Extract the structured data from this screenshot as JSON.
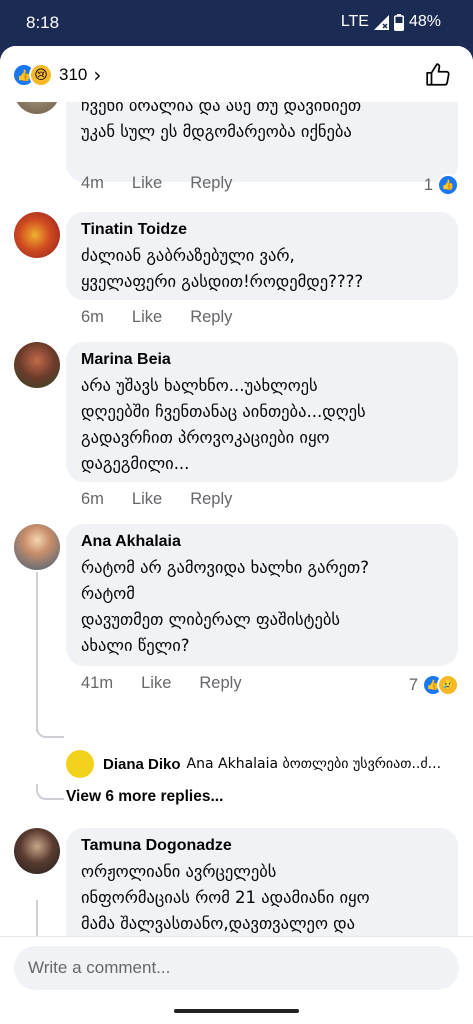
{
  "status": {
    "time": "8:18",
    "network": "LTE",
    "battery": "48%"
  },
  "header": {
    "reaction_count": "310",
    "icons": [
      "like-icon",
      "sad-icon",
      "chevron-right-icon",
      "thumbs-up-icon"
    ]
  },
  "comments": [
    {
      "author": "",
      "text": "ჩვენი ბრალია და ასე თუ დავიხიეთ\nუკან სულ ეს მდგომარეობა იქნება",
      "time": "4m",
      "like": "Like",
      "reply": "Reply",
      "reactions": "1"
    },
    {
      "author": "Tinatin Toidze",
      "text": "ძალიან გაბრაზებული ვარ,\nყველაფერი გასდით!როდემდე????",
      "time": "6m",
      "like": "Like",
      "reply": "Reply"
    },
    {
      "author": "Marina Beia",
      "text": "არა უშავს  ხალხნო...უახლოეს\nდღეებში ჩვენთანაც აინთება...დღეს\nგადავრჩით პროვოკაციები იყო\nდაგეგმილი...",
      "time": "6m",
      "like": "Like",
      "reply": "Reply"
    },
    {
      "author": "Ana Akhalaia",
      "text": "რატომ არ გამოვიდა ხალხი გარეთ?\nრატომ\nდავუთმეთ ლიბერალ ფაშისტებს\nახალი წელი?",
      "time": "41m",
      "like": "Like",
      "reply": "Reply",
      "reactions": "7",
      "reply_preview": {
        "author": "Diana Diko",
        "text": "Ana Akhalaia ბოთლები უსვრიათ..ძ..."
      },
      "more_replies": "View 6 more replies..."
    },
    {
      "author": "Tamuna Dogonadze",
      "text": "ორჟოლიანი ავრცელებს\nინფორმაციას რომ 21 ადამიანი იყო\nმამა შალვასთანო,დავთვალეო და\nბებრები მიიყვანეს ნაძვის\nხესთანო.....ვახ ბიჭო"
    }
  ],
  "composer": {
    "placeholder": "Write a comment..."
  }
}
